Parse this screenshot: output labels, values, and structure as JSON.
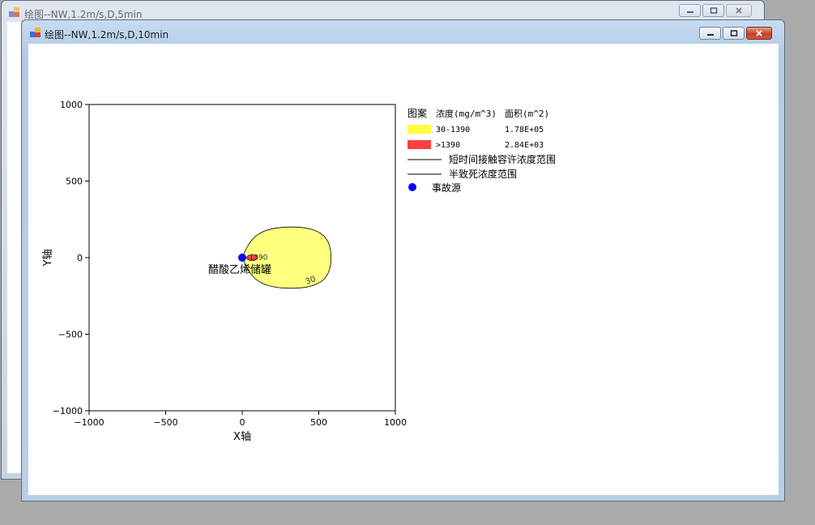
{
  "windows": {
    "back": {
      "title": "绘图--NW,1.2m/s,D,5min"
    },
    "front": {
      "title": "绘图--NW,1.2m/s,D,10min"
    }
  },
  "chart_data": {
    "type": "contour",
    "xlabel": "X轴",
    "ylabel": "Y轴",
    "xlim": [
      -1000,
      1000
    ],
    "ylim": [
      -1000,
      1000
    ],
    "xticks": [
      -1000,
      -500,
      0,
      500,
      1000
    ],
    "yticks": [
      1000,
      500,
      0,
      -500,
      -1000
    ],
    "xtick_labels": [
      "−1000",
      "−500",
      "0",
      "500",
      "1000"
    ],
    "ytick_labels": [
      "1000",
      "500",
      "0",
      "−500",
      "−1000"
    ],
    "grid": false,
    "source": {
      "x": 0,
      "y": 0,
      "label": "醋酸乙烯储罐",
      "color": "#0000ff"
    },
    "contours": [
      {
        "level_label": "30",
        "color": "#ffff80",
        "x_min": 0,
        "x_max": 580,
        "y_min": -200,
        "y_max": 200,
        "peak_x": 320
      },
      {
        "level_label": "1390",
        "color": "#ff4040",
        "x_min": 30,
        "x_max": 100,
        "y_min": -25,
        "y_max": 25
      }
    ],
    "legend": {
      "position": "right",
      "headers": [
        "图案",
        "浓度(mg/m^3)",
        "面积(m^2)"
      ],
      "rows": [
        {
          "swatch": "#ffff40",
          "range": "30-1390",
          "area": "1.78E+05"
        },
        {
          "swatch": "#ff4040",
          "range": ">1390",
          "area": "2.84E+03"
        }
      ],
      "lines": [
        "短时间接触容许浓度范围",
        "半致死浓度范围"
      ],
      "marker": "事故源"
    }
  },
  "icons": {
    "app": "app-icon",
    "minimize": "minimize-icon",
    "maximize": "maximize-icon",
    "close": "close-icon"
  }
}
